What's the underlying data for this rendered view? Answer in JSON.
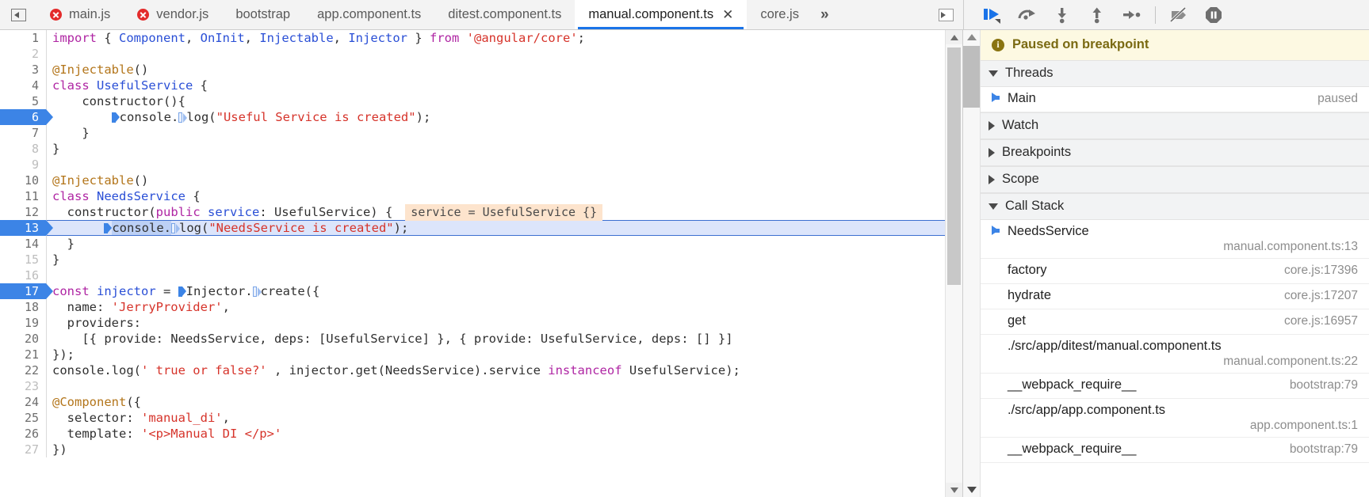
{
  "topbar": {
    "panel_toggle_name": "show-navigator-panel",
    "tabs": [
      {
        "label": "main.js",
        "error": true,
        "active": false,
        "closable": false
      },
      {
        "label": "vendor.js",
        "error": true,
        "active": false,
        "closable": false
      },
      {
        "label": "bootstrap",
        "error": false,
        "active": false,
        "closable": false
      },
      {
        "label": "app.component.ts",
        "error": false,
        "active": false,
        "closable": false
      },
      {
        "label": "ditest.component.ts",
        "error": false,
        "active": false,
        "closable": false
      },
      {
        "label": "manual.component.ts",
        "error": false,
        "active": true,
        "closable": true
      },
      {
        "label": "core.js",
        "error": false,
        "active": false,
        "closable": false
      }
    ],
    "more_tabs_label": "»",
    "close_label": "✕",
    "show_debugger_panel_name": "show-debugger-sidebar"
  },
  "debug_toolbar": {
    "buttons": [
      {
        "name": "resume-script-execution",
        "title": "Resume"
      },
      {
        "name": "step-over-next-function-call",
        "title": "Step over next function call"
      },
      {
        "name": "step-into-next-function-call",
        "title": "Step into next function call"
      },
      {
        "name": "step-out-of-current-function",
        "title": "Step out of current function"
      },
      {
        "name": "step",
        "title": "Step"
      },
      {
        "name": "deactivate-breakpoints",
        "title": "Deactivate breakpoints"
      },
      {
        "name": "pause-on-exceptions",
        "title": "Pause on exceptions"
      }
    ],
    "accent_color": "#1a73e8",
    "icon_color": "#6e6e6e"
  },
  "editor": {
    "lines": [
      {
        "n": "1",
        "bp": false,
        "exec": false,
        "tokens": [
          {
            "t": "import ",
            "c": "kw"
          },
          {
            "t": "{ ",
            "c": "plain"
          },
          {
            "t": "Component",
            "c": "cls"
          },
          {
            "t": ", ",
            "c": "plain"
          },
          {
            "t": "OnInit",
            "c": "cls"
          },
          {
            "t": ", ",
            "c": "plain"
          },
          {
            "t": "Injectable",
            "c": "cls"
          },
          {
            "t": ", ",
            "c": "plain"
          },
          {
            "t": "Injector",
            "c": "cls"
          },
          {
            "t": " } ",
            "c": "plain"
          },
          {
            "t": "from ",
            "c": "kw"
          },
          {
            "t": "'@angular/core'",
            "c": "str"
          },
          {
            "t": ";",
            "c": "plain"
          }
        ]
      },
      {
        "n": "2",
        "dim": true,
        "bp": false,
        "exec": false,
        "tokens": []
      },
      {
        "n": "3",
        "bp": false,
        "exec": false,
        "tokens": [
          {
            "t": "@Injectable",
            "c": "dec"
          },
          {
            "t": "()",
            "c": "plain"
          }
        ]
      },
      {
        "n": "4",
        "bp": false,
        "exec": false,
        "tokens": [
          {
            "t": "class ",
            "c": "kw"
          },
          {
            "t": "UsefulService",
            "c": "cls"
          },
          {
            "t": " {",
            "c": "plain"
          }
        ]
      },
      {
        "n": "5",
        "bp": false,
        "exec": false,
        "tokens": [
          {
            "t": "    constructor(){",
            "c": "plain"
          }
        ]
      },
      {
        "n": "6",
        "bp": true,
        "exec": false,
        "tokens": [
          {
            "t": "        ",
            "c": "plain"
          },
          {
            "t": "",
            "c": "bp-solid"
          },
          {
            "t": "console.",
            "c": "plain"
          },
          {
            "t": "",
            "c": "bp-hollow"
          },
          {
            "t": "log(",
            "c": "plain"
          },
          {
            "t": "\"Useful Service is created\"",
            "c": "str"
          },
          {
            "t": ");",
            "c": "plain"
          }
        ]
      },
      {
        "n": "7",
        "bp": false,
        "exec": false,
        "tokens": [
          {
            "t": "    }",
            "c": "plain"
          }
        ]
      },
      {
        "n": "8",
        "dim": true,
        "bp": false,
        "exec": false,
        "tokens": [
          {
            "t": "}",
            "c": "plain"
          }
        ]
      },
      {
        "n": "9",
        "dim": true,
        "bp": false,
        "exec": false,
        "tokens": []
      },
      {
        "n": "10",
        "bp": false,
        "exec": false,
        "tokens": [
          {
            "t": "@Injectable",
            "c": "dec"
          },
          {
            "t": "()",
            "c": "plain"
          }
        ]
      },
      {
        "n": "11",
        "bp": false,
        "exec": false,
        "tokens": [
          {
            "t": "class ",
            "c": "kw"
          },
          {
            "t": "NeedsService",
            "c": "cls"
          },
          {
            "t": " {",
            "c": "plain"
          }
        ]
      },
      {
        "n": "12",
        "bp": false,
        "exec": false,
        "hint": "service = UsefulService {}",
        "tokens": [
          {
            "t": "  constructor(",
            "c": "plain"
          },
          {
            "t": "public ",
            "c": "kw"
          },
          {
            "t": "service",
            "c": "cls"
          },
          {
            "t": ": UsefulService) {",
            "c": "plain"
          }
        ]
      },
      {
        "n": "13",
        "bp": true,
        "exec": true,
        "tokens": [
          {
            "t": "       ",
            "c": "plain"
          },
          {
            "t": "",
            "c": "bp-solid"
          },
          {
            "t": "console.",
            "c": "sel"
          },
          {
            "t": "",
            "c": "bp-hollow"
          },
          {
            "t": "log(",
            "c": "plain"
          },
          {
            "t": "\"NeedsService is created\"",
            "c": "str"
          },
          {
            "t": ");",
            "c": "plain"
          }
        ]
      },
      {
        "n": "14",
        "bp": false,
        "exec": false,
        "tokens": [
          {
            "t": "  }",
            "c": "plain"
          }
        ]
      },
      {
        "n": "15",
        "dim": true,
        "bp": false,
        "exec": false,
        "tokens": [
          {
            "t": "}",
            "c": "plain"
          }
        ]
      },
      {
        "n": "16",
        "dim": true,
        "bp": false,
        "exec": false,
        "tokens": []
      },
      {
        "n": "17",
        "bp": true,
        "exec": false,
        "tokens": [
          {
            "t": "const ",
            "c": "kw"
          },
          {
            "t": "injector",
            "c": "cls"
          },
          {
            "t": " = ",
            "c": "plain"
          },
          {
            "t": "",
            "c": "bp-solid"
          },
          {
            "t": "Injector.",
            "c": "plain"
          },
          {
            "t": "",
            "c": "bp-hollow"
          },
          {
            "t": "create({",
            "c": "plain"
          }
        ]
      },
      {
        "n": "18",
        "bp": false,
        "exec": false,
        "tokens": [
          {
            "t": "  name: ",
            "c": "plain"
          },
          {
            "t": "'JerryProvider'",
            "c": "str"
          },
          {
            "t": ",",
            "c": "plain"
          }
        ]
      },
      {
        "n": "19",
        "bp": false,
        "exec": false,
        "tokens": [
          {
            "t": "  providers:",
            "c": "plain"
          }
        ]
      },
      {
        "n": "20",
        "bp": false,
        "exec": false,
        "tokens": [
          {
            "t": "    [{ provide: NeedsService, deps: [UsefulService] }, { provide: UsefulService, deps: [] }]",
            "c": "plain"
          }
        ]
      },
      {
        "n": "21",
        "bp": false,
        "exec": false,
        "tokens": [
          {
            "t": "});",
            "c": "plain"
          }
        ]
      },
      {
        "n": "22",
        "bp": false,
        "exec": false,
        "tokens": [
          {
            "t": "console.log(",
            "c": "plain"
          },
          {
            "t": "' true or false?'",
            "c": "str"
          },
          {
            "t": " , injector.get(NeedsService).service ",
            "c": "plain"
          },
          {
            "t": "instanceof",
            "c": "kw"
          },
          {
            "t": " UsefulService);",
            "c": "plain"
          }
        ]
      },
      {
        "n": "23",
        "dim": true,
        "bp": false,
        "exec": false,
        "tokens": []
      },
      {
        "n": "24",
        "bp": false,
        "exec": false,
        "tokens": [
          {
            "t": "@Component",
            "c": "dec"
          },
          {
            "t": "({",
            "c": "plain"
          }
        ]
      },
      {
        "n": "25",
        "bp": false,
        "exec": false,
        "tokens": [
          {
            "t": "  selector: ",
            "c": "plain"
          },
          {
            "t": "'manual_di'",
            "c": "str"
          },
          {
            "t": ",",
            "c": "plain"
          }
        ]
      },
      {
        "n": "26",
        "bp": false,
        "exec": false,
        "tokens": [
          {
            "t": "  template: ",
            "c": "plain"
          },
          {
            "t": "'<p>Manual DI </p>'",
            "c": "str"
          }
        ]
      },
      {
        "n": "27",
        "dim": true,
        "bp": false,
        "exec": false,
        "tokens": [
          {
            "t": "})",
            "c": "plain"
          }
        ]
      }
    ]
  },
  "sidebar": {
    "paused_banner": "Paused on breakpoint",
    "sections": [
      {
        "label": "Threads",
        "expanded": true
      },
      {
        "label": "Watch",
        "expanded": false
      },
      {
        "label": "Breakpoints",
        "expanded": false
      },
      {
        "label": "Scope",
        "expanded": false
      },
      {
        "label": "Call Stack",
        "expanded": true
      }
    ],
    "threads": [
      {
        "name": "Main",
        "status": "paused",
        "current": true
      }
    ],
    "call_stack": [
      {
        "name": "NeedsService",
        "location": "manual.component.ts:13",
        "current": true,
        "stacked": true
      },
      {
        "name": "factory",
        "location": "core.js:17396",
        "current": false,
        "stacked": false
      },
      {
        "name": "hydrate",
        "location": "core.js:17207",
        "current": false,
        "stacked": false
      },
      {
        "name": "get",
        "location": "core.js:16957",
        "current": false,
        "stacked": false
      },
      {
        "name": "./src/app/ditest/manual.component.ts",
        "location": "manual.component.ts:22",
        "current": false,
        "stacked": true
      },
      {
        "name": "__webpack_require__",
        "location": "bootstrap:79",
        "current": false,
        "stacked": false
      },
      {
        "name": "./src/app/app.component.ts",
        "location": "app.component.ts:1",
        "current": false,
        "stacked": true
      },
      {
        "name": "__webpack_require__",
        "location": "bootstrap:79",
        "current": false,
        "stacked": false
      }
    ]
  }
}
